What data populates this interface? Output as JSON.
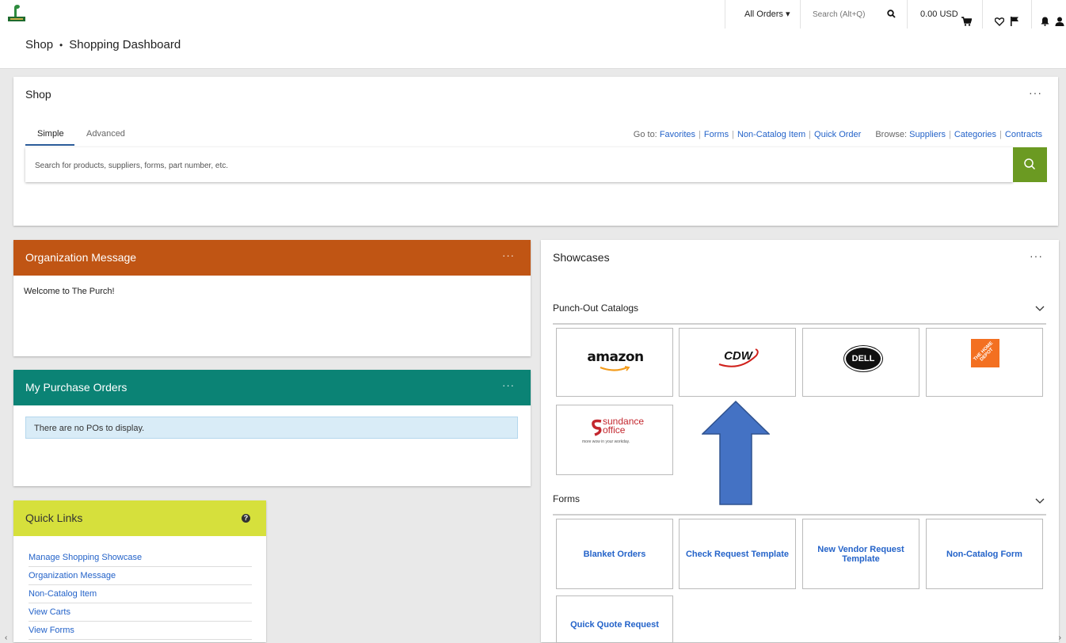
{
  "topbar": {
    "logo": "organization-logo",
    "orders_menu": "All Orders ▾",
    "search_placeholder": "Search (Alt+Q)",
    "cart_total": "0.00 USD",
    "icons": [
      "search-icon",
      "cart-icon",
      "heart-icon",
      "flag-icon",
      "bell-icon",
      "user-icon"
    ]
  },
  "breadcrumb": {
    "root": "Shop",
    "separator": "•",
    "current": "Shopping Dashboard"
  },
  "shop_panel": {
    "title": "Shop",
    "menu": "···",
    "tabs": [
      {
        "label": "Simple",
        "active": true
      },
      {
        "label": "Advanced",
        "active": false
      }
    ],
    "goto_label": "Go to:",
    "goto_links": [
      "Favorites",
      "Forms",
      "Non-Catalog Item",
      "Quick Order"
    ],
    "browse_label": "Browse:",
    "browse_links": [
      "Suppliers",
      "Categories",
      "Contracts"
    ],
    "search_placeholder": "Search for products, suppliers, forms, part number, etc."
  },
  "org_message": {
    "title": "Organization Message",
    "menu": "···",
    "body": "Welcome to The Purch!",
    "header_color": "#c05514"
  },
  "purchase_orders": {
    "title": "My Purchase Orders",
    "menu": "···",
    "empty_text": "There are no POs to display.",
    "header_color": "#0b8375"
  },
  "quick_links": {
    "title": "Quick Links",
    "help": "?",
    "header_color": "#d6e03c",
    "items": [
      "Manage Shopping Showcase",
      "Organization Message",
      "Non-Catalog Item",
      "View Carts",
      "View Forms"
    ]
  },
  "showcases": {
    "title": "Showcases",
    "menu": "···",
    "punchout_title": "Punch-Out Catalogs",
    "catalogs": [
      {
        "name": "amazon",
        "logo": "amazon-logo"
      },
      {
        "name": "CDW",
        "logo": "cdw-logo"
      },
      {
        "name": "DELL",
        "logo": "dell-logo"
      },
      {
        "name": "THE HOME DEPOT",
        "logo": "home-depot-logo"
      },
      {
        "name": "sundance office",
        "tagline": "more wow in your workday.",
        "logo": "sundance-office-logo"
      }
    ],
    "forms_title": "Forms",
    "forms": [
      "Blanket Orders",
      "Check Request Template",
      "New Vendor Request Template",
      "Non-Catalog Form",
      "Quick Quote Request"
    ]
  },
  "colors": {
    "link": "#2463c9",
    "search_button": "#6b9a22",
    "annotation_arrow": "#4472c4"
  }
}
